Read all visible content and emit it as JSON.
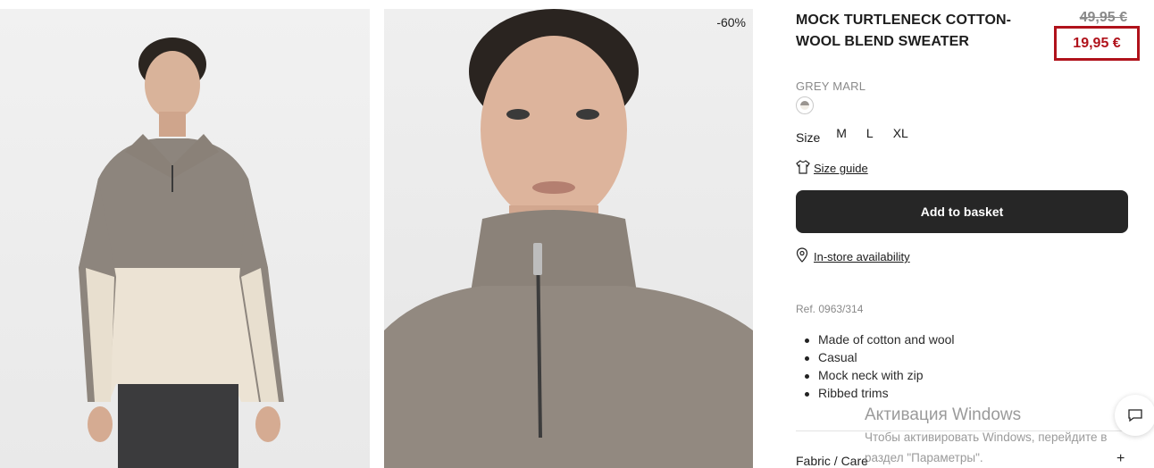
{
  "product": {
    "title": "MOCK TURTLENECK COTTON-WOOL BLEND SWEATER",
    "price_old": "49,95 €",
    "price_new": "19,95 €",
    "discount": "-60%",
    "color_name": "GREY MARL",
    "size_label": "Size",
    "sizes": [
      "M",
      "L",
      "XL"
    ],
    "size_guide": "Size guide",
    "add_button": "Add to basket",
    "store_availability": "In-store availability",
    "ref": "Ref. 0963/314",
    "features": [
      "Made of cotton and wool",
      "Casual",
      "Mock neck with zip",
      "Ribbed trims"
    ],
    "fabric_care": "Fabric / Care",
    "fabric_toggle": "+"
  },
  "watermark": {
    "line1": "Активация Windows",
    "line2": "Чтобы активировать Windows, перейдите в",
    "line3": "раздел \"Параметры\"."
  },
  "colors": {
    "sale": "#b0121b",
    "button": "#262626",
    "muted": "#8a8a8a"
  },
  "icons": [
    "tshirt-icon",
    "location-pin-icon",
    "chat-icon",
    "plus-icon"
  ]
}
